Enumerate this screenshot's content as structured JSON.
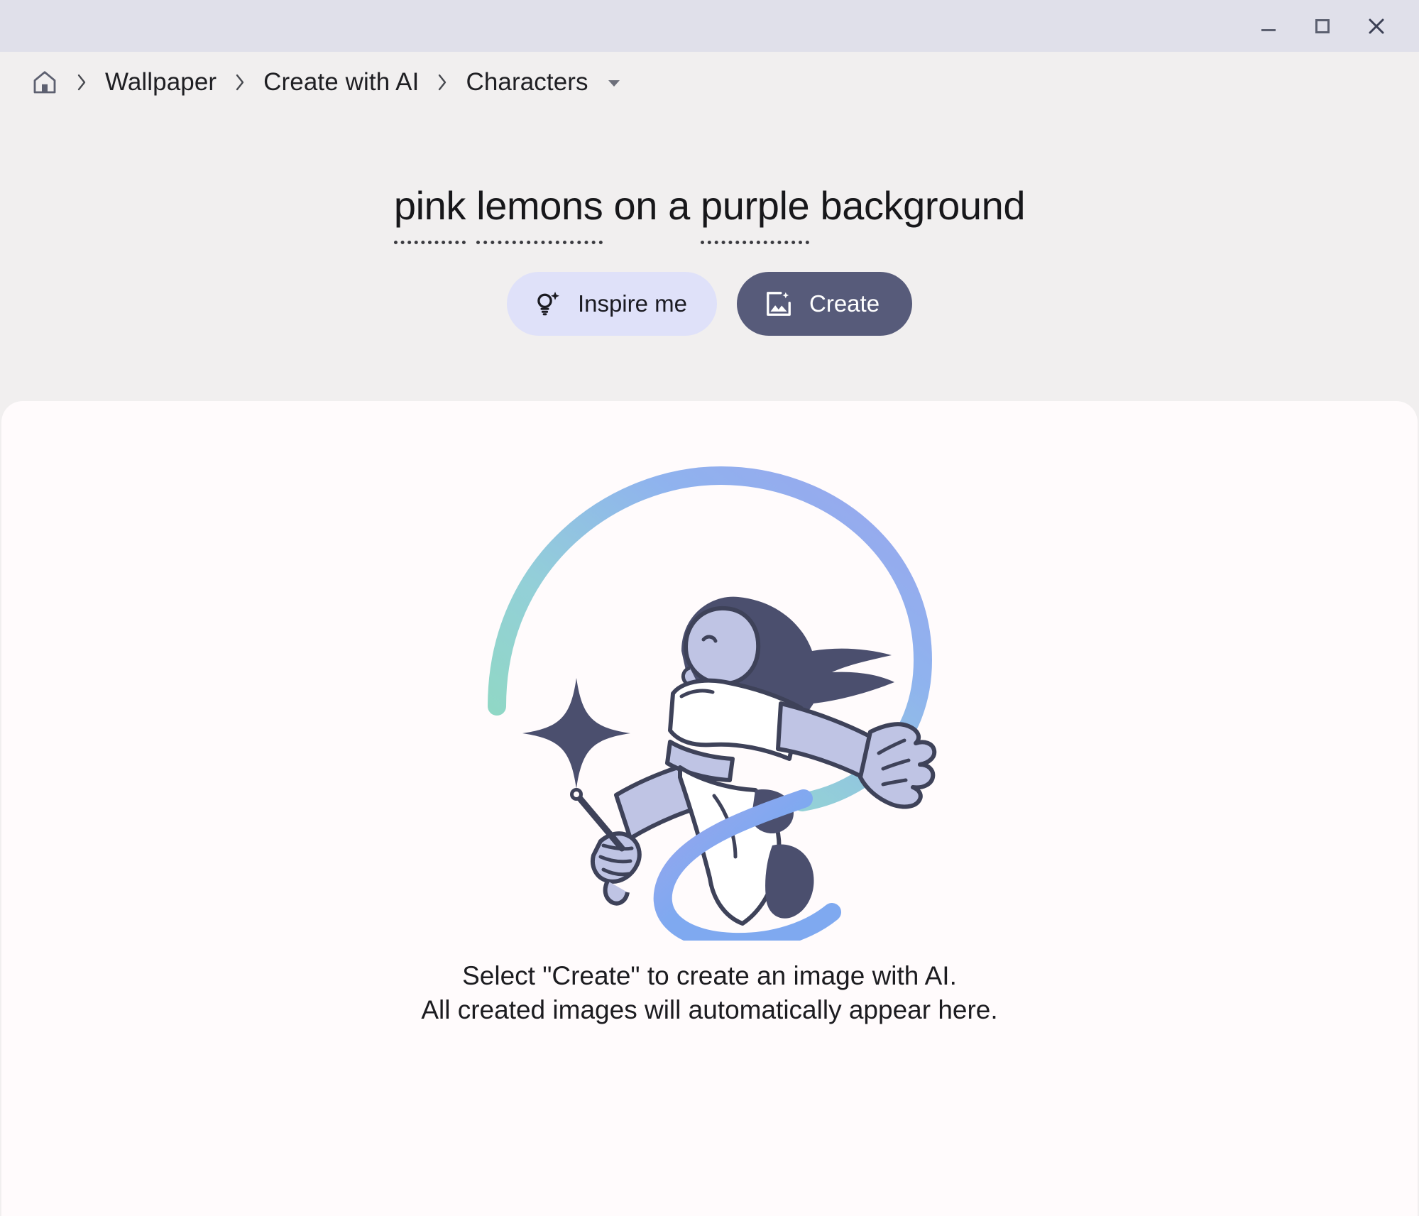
{
  "window": {
    "controls": [
      {
        "name": "minimize",
        "label": "Minimize"
      },
      {
        "name": "maximize",
        "label": "Maximize"
      },
      {
        "name": "close",
        "label": "Close"
      }
    ],
    "titlebar_color": "#e0e0ea",
    "header_color": "#f1efef",
    "panel_color": "#fffbfc"
  },
  "breadcrumb": {
    "home_icon": "home-icon",
    "separator": "›",
    "items": [
      {
        "label": "Wallpaper"
      },
      {
        "label": "Create with AI"
      },
      {
        "label": "Characters"
      }
    ],
    "caret_icon": "chevron-down-icon"
  },
  "prompt": {
    "segments": [
      {
        "text": "pink",
        "spellcheck": true
      },
      {
        "text": " ",
        "spellcheck": false
      },
      {
        "text": "lemons",
        "spellcheck": true
      },
      {
        "text": " on a ",
        "spellcheck": false
      },
      {
        "text": "purple",
        "spellcheck": true
      },
      {
        "text": " background",
        "spellcheck": false
      }
    ],
    "full_text": "pink lemons on a purple background"
  },
  "actions": {
    "inspire": {
      "label": "Inspire me",
      "icon": "lightbulb-sparkle-icon",
      "bg": "#dfe1f9",
      "fg": "#1b1b22"
    },
    "create": {
      "label": "Create",
      "icon": "image-sparkle-icon",
      "bg": "#575b7a",
      "fg": "#ffffff"
    }
  },
  "empty_state": {
    "illustration": "person-with-wand-and-ribbon-illustration",
    "line1": "Select \"Create\" to create an image with AI.",
    "line2": "All created images will automatically appear here.",
    "colors": {
      "ribbon_green": "#8fdcbc",
      "ribbon_blue": "#7fa9f0",
      "ribbon_purple": "#9aa5ee",
      "ink": "#4b4f६e",
      "ink_dark": "#4b4f6e",
      "garment": "#ffffff",
      "sleeve": "#bfc4e4"
    }
  }
}
